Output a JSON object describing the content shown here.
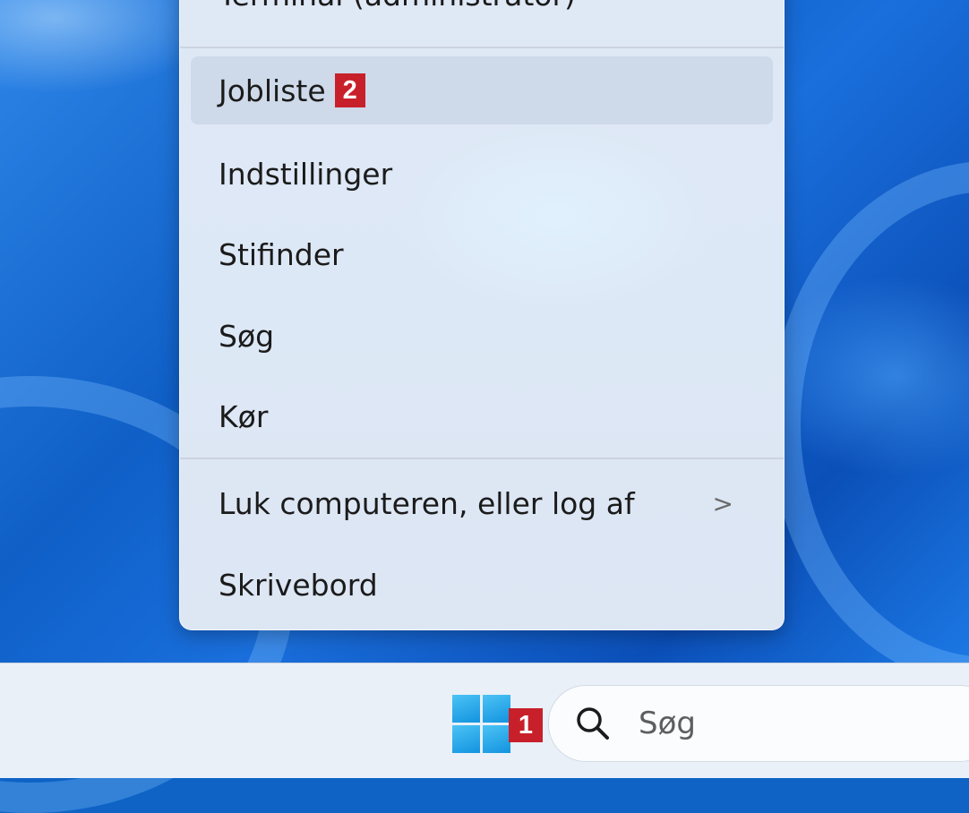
{
  "menu": {
    "items": [
      {
        "label": "Terminal (administrator)"
      },
      {
        "label": "Jobliste",
        "badge": "2"
      },
      {
        "label": "Indstillinger"
      },
      {
        "label": "Stifinder"
      },
      {
        "label": "Søg"
      },
      {
        "label": "Kør"
      },
      {
        "label": "Luk computeren, eller log af",
        "chevron": ">"
      },
      {
        "label": "Skrivebord"
      }
    ]
  },
  "taskbar": {
    "start_badge": "1",
    "search_placeholder": "Søg",
    "start_icon": "windows-logo-icon",
    "search_icon": "search-icon"
  },
  "colors": {
    "badge": "#c8202a",
    "accent": "#1393e0",
    "menu_bg": "#dfe8f5"
  }
}
